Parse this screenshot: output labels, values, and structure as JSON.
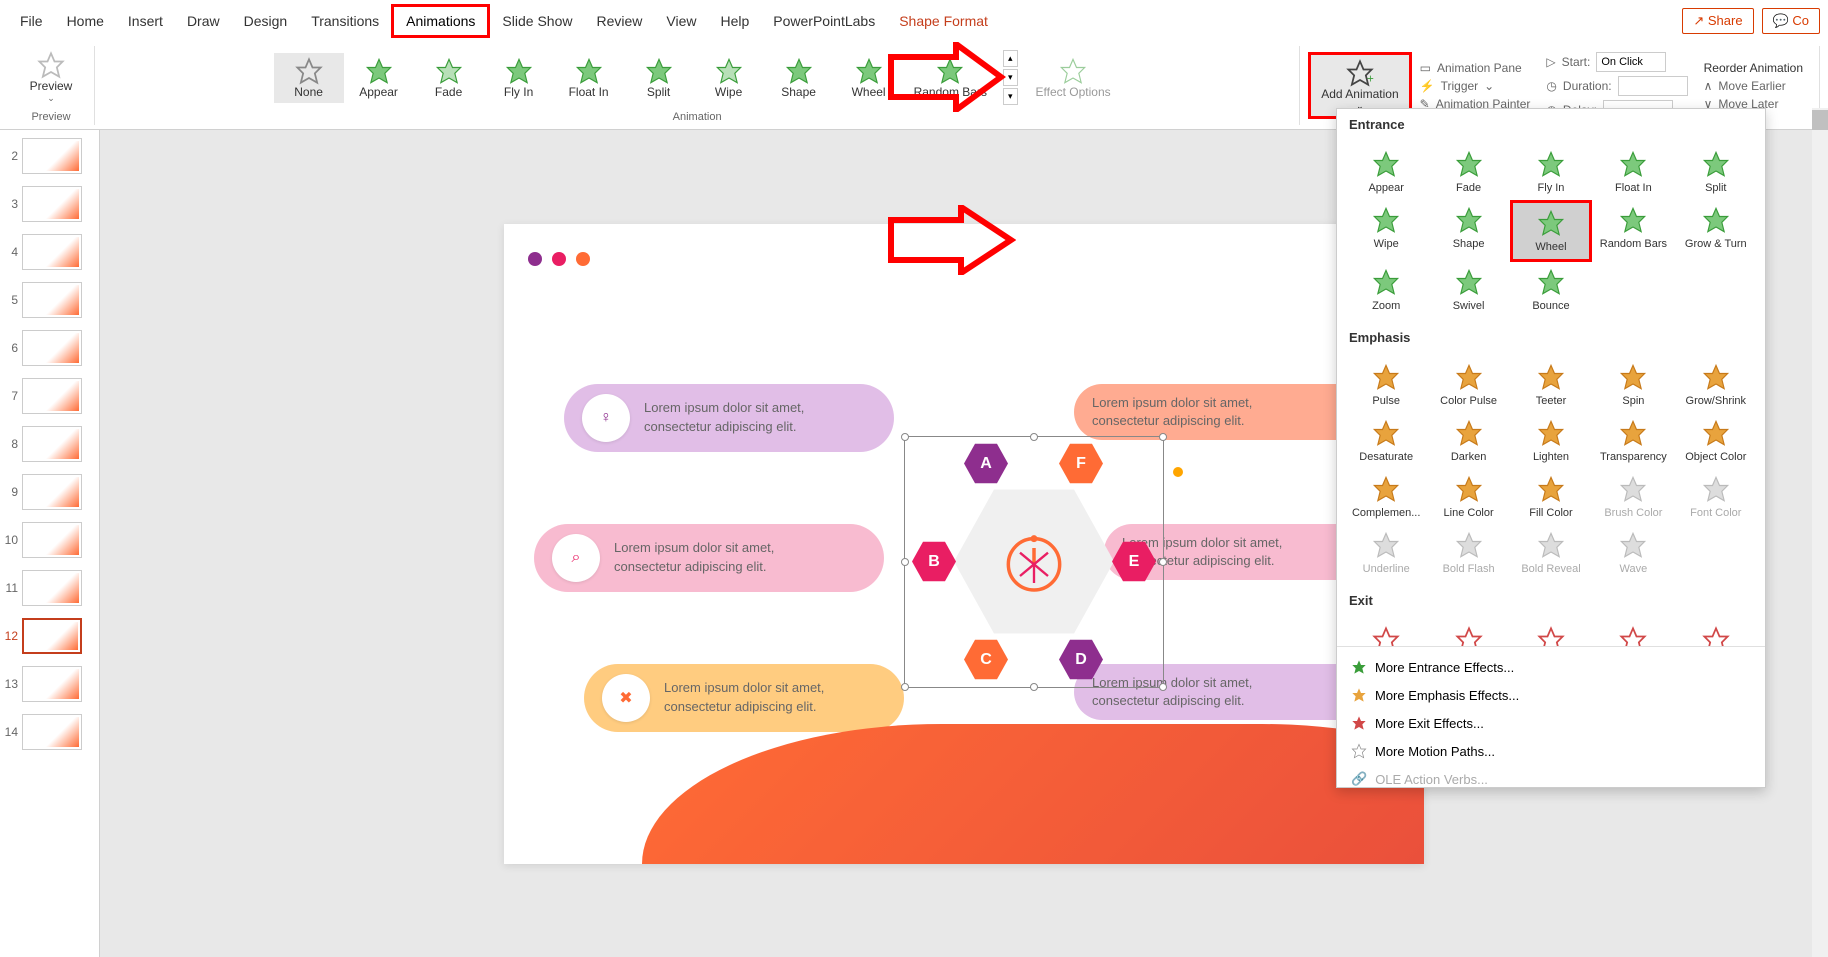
{
  "tabs": {
    "file": "File",
    "home": "Home",
    "insert": "Insert",
    "draw": "Draw",
    "design": "Design",
    "transitions": "Transitions",
    "animations": "Animations",
    "slideshow": "Slide Show",
    "review": "Review",
    "view": "View",
    "help": "Help",
    "ppl": "PowerPointLabs",
    "shapeformat": "Shape Format"
  },
  "share": "Share",
  "comments_partial": "Co",
  "preview": {
    "label": "Preview",
    "group": "Preview"
  },
  "animation_gallery": {
    "none": "None",
    "appear": "Appear",
    "fade": "Fade",
    "flyin": "Fly In",
    "floatin": "Float In",
    "split": "Split",
    "wipe": "Wipe",
    "shape": "Shape",
    "wheel": "Wheel",
    "randombars": "Random Bars",
    "group": "Animation"
  },
  "effect_options": "Effect Options",
  "add_animation": "Add Animation",
  "advanced": {
    "pane": "Animation Pane",
    "trigger": "Trigger",
    "painter": "Animation Painter",
    "start": "Start:",
    "start_value": "On Click",
    "duration": "Duration:",
    "delay": "Delay:",
    "reorder": "Reorder Animation",
    "earlier": "Move Earlier",
    "later": "Move Later"
  },
  "dropdown": {
    "entrance": "Entrance",
    "emphasis": "Emphasis",
    "exit": "Exit",
    "entrance_items": {
      "appear": "Appear",
      "fade": "Fade",
      "flyin": "Fly In",
      "floatin": "Float In",
      "split": "Split",
      "wipe": "Wipe",
      "shape": "Shape",
      "wheel": "Wheel",
      "randombars": "Random Bars",
      "growturn": "Grow & Turn",
      "zoom": "Zoom",
      "swivel": "Swivel",
      "bounce": "Bounce"
    },
    "emphasis_items": {
      "pulse": "Pulse",
      "colorpulse": "Color Pulse",
      "teeter": "Teeter",
      "spin": "Spin",
      "growshrink": "Grow/Shrink",
      "desaturate": "Desaturate",
      "darken": "Darken",
      "lighten": "Lighten",
      "transparency": "Transparency",
      "objectcolor": "Object Color",
      "complemen": "Complemen...",
      "linecolor": "Line Color",
      "fillcolor": "Fill Color",
      "brushcolor": "Brush Color",
      "fontcolor": "Font Color",
      "underline": "Underline",
      "boldflash": "Bold Flash",
      "boldreveal": "Bold Reveal",
      "wave": "Wave"
    },
    "more_entrance": "More Entrance Effects...",
    "more_emphasis": "More Emphasis Effects...",
    "more_exit": "More Exit Effects...",
    "more_motion": "More Motion Paths...",
    "ole": "OLE Action Verbs..."
  },
  "slides": [
    "2",
    "3",
    "4",
    "5",
    "6",
    "7",
    "8",
    "9",
    "10",
    "11",
    "12",
    "13",
    "14"
  ],
  "active_slide": "12",
  "slide_content": {
    "lorem1": "Lorem ipsum dolor sit amet,",
    "lorem2": "consectetur adipiscing elit.",
    "hexA": "A",
    "hexB": "B",
    "hexC": "C",
    "hexD": "D",
    "hexE": "E",
    "hexF": "F"
  },
  "colors": {
    "purple": "#8e2e8e",
    "pink": "#e91e63",
    "orange": "#ff6b35",
    "magenta": "#c2185b",
    "lightpink": "#f8bbd0",
    "lightorange": "#ffcc80",
    "lightpurple": "#e1bee7"
  }
}
